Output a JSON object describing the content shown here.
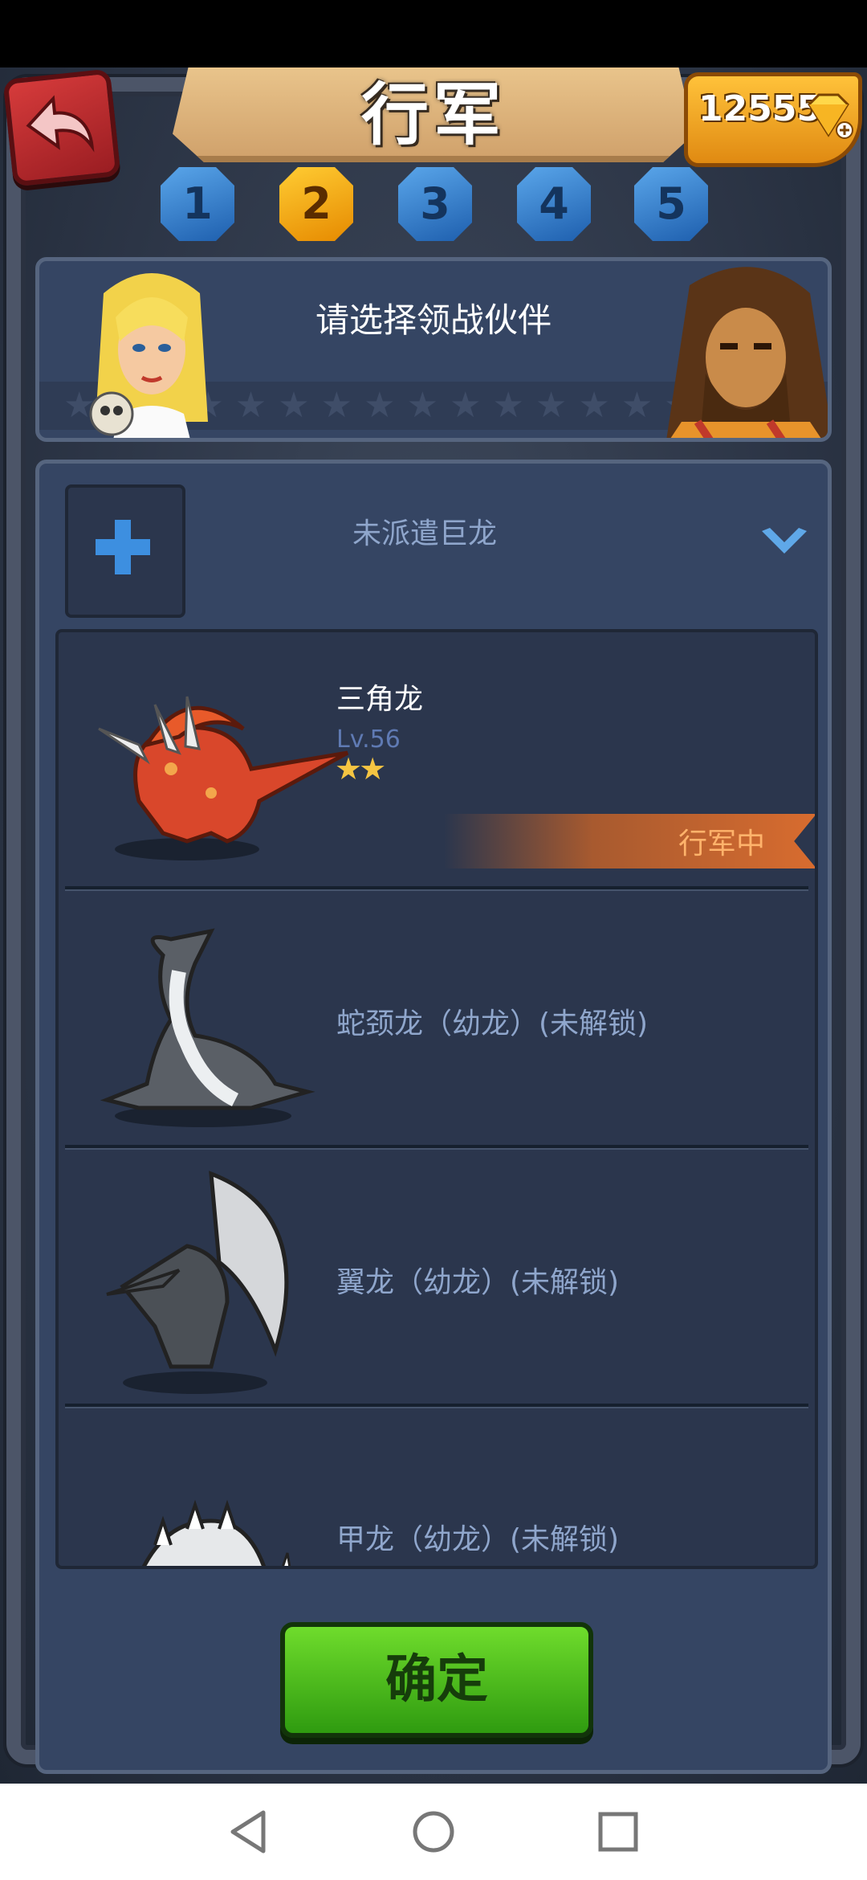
{
  "header": {
    "title": "行军",
    "gems": "12555"
  },
  "tabs": [
    "1",
    "2",
    "3",
    "4",
    "5"
  ],
  "active_tab": "2",
  "banner": {
    "prompt": "请选择领战伙伴"
  },
  "slot": {
    "status": "未派遣巨龙"
  },
  "dragons": [
    {
      "name": "三角龙",
      "level": "Lv.56",
      "stars": 2,
      "status": "行军中"
    },
    {
      "name": "蛇颈龙（幼龙）(未解锁)"
    },
    {
      "name": "翼龙（幼龙）(未解锁)"
    },
    {
      "name": "甲龙（幼龙）(未解锁)"
    }
  ],
  "confirm_label": "确定",
  "colors": {
    "panel": "#354563",
    "tab_active": "#f2a30f",
    "tab_inactive": "#2e78c8",
    "confirm_green": "#4cb51f",
    "marching_text": "#ffb36b"
  }
}
